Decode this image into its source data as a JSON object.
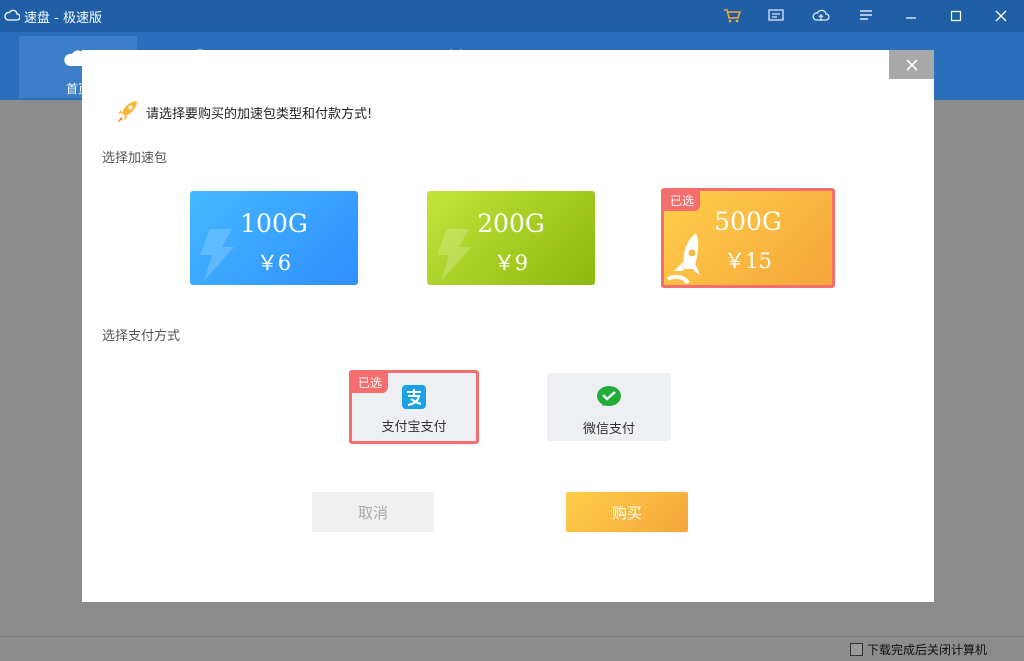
{
  "app": {
    "title": "速盘 - 极速版"
  },
  "nav": {
    "tabs": [
      {
        "label": "首页",
        "icon": "cloud-icon",
        "active": true
      },
      {
        "label": "",
        "icon": "search-icon"
      },
      {
        "label": "",
        "icon": "download-icon"
      },
      {
        "label": "",
        "icon": "tools-icon"
      }
    ]
  },
  "modal": {
    "prompt": "请选择要购买的加速包类型和付款方式!",
    "package_section_label": "选择加速包",
    "packages": [
      {
        "size": "100G",
        "price": "￥6",
        "selected": false,
        "color": "#3aa6ff"
      },
      {
        "size": "200G",
        "price": "￥9",
        "selected": false,
        "color": "#a9cf25"
      },
      {
        "size": "500G",
        "price": "￥15",
        "selected": true,
        "color": "#f8b842"
      }
    ],
    "selected_tag": "已选",
    "payment_section_label": "选择支付方式",
    "payments": [
      {
        "label": "支付宝支付",
        "icon": "alipay-icon",
        "selected": true
      },
      {
        "label": "微信支付",
        "icon": "wechat-pay-icon",
        "selected": false
      }
    ],
    "cancel_label": "取消",
    "buy_label": "购买"
  },
  "statusbar": {
    "auto_shutdown_label": "下载完成后关闭计算机",
    "auto_shutdown_checked": false
  },
  "colors": {
    "titlebar": "#1e5fa6",
    "accent_selected": "#f56e6e",
    "buy_button": "#f8b842"
  }
}
